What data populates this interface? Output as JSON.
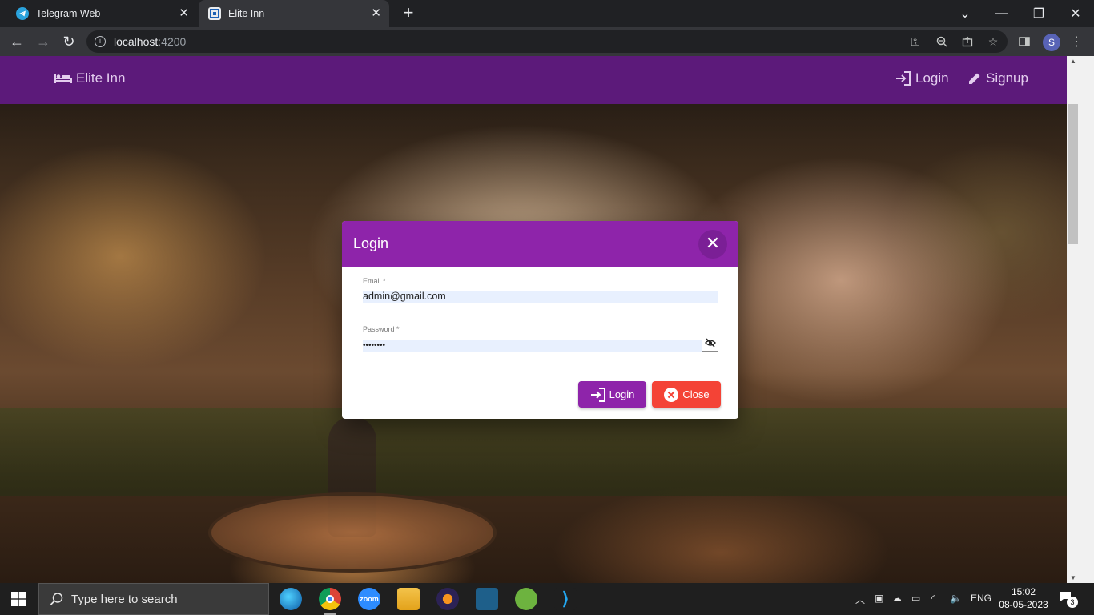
{
  "browser": {
    "tabs": [
      {
        "title": "Telegram Web",
        "active": false
      },
      {
        "title": "Elite Inn",
        "active": true
      }
    ],
    "address": {
      "host": "localhost",
      "port": ":4200"
    },
    "profile_initial": "S"
  },
  "app": {
    "brand": "Elite Inn",
    "nav": {
      "login_label": "Login",
      "signup_label": "Signup"
    },
    "colors": {
      "appbar": "#5c1a7a",
      "dialog_header": "#8e24aa",
      "close_button": "#f44336"
    }
  },
  "dialog": {
    "title": "Login",
    "email_label": "Email *",
    "email_value": "admin@gmail.com",
    "password_label": "Password *",
    "password_value": "••••••••",
    "login_button": "Login",
    "close_button": "Close"
  },
  "taskbar": {
    "search_placeholder": "Type here to search",
    "language": "ENG",
    "time": "15:02",
    "date": "08-05-2023",
    "notification_count": "3",
    "apps": [
      "edge-icon",
      "chrome-icon",
      "zoom-icon",
      "file-explorer-icon",
      "eclipse-icon",
      "mysql-workbench-icon",
      "spring-tools-icon",
      "vscode-icon"
    ]
  }
}
